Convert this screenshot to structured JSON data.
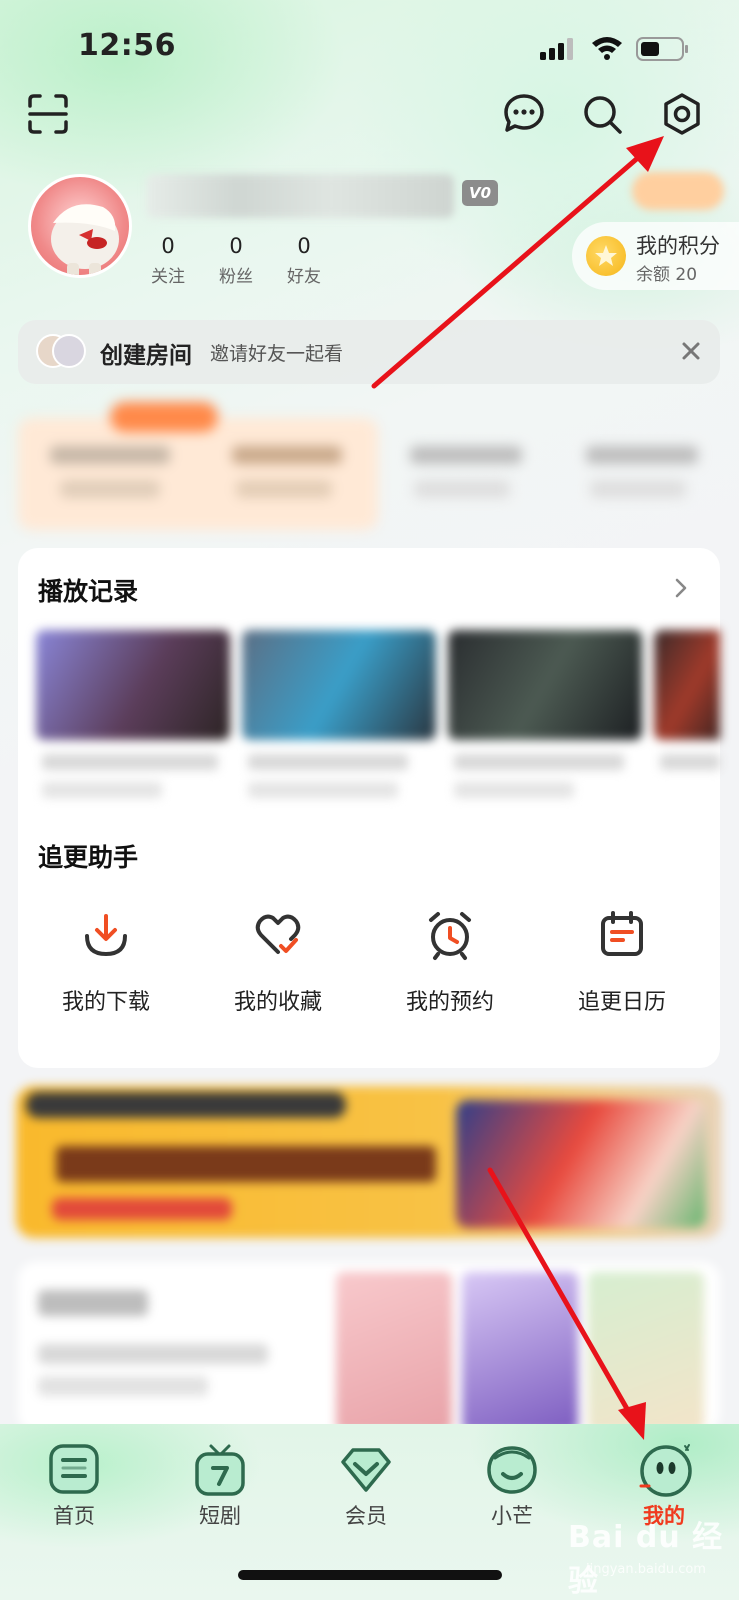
{
  "status_bar": {
    "time": "12:56"
  },
  "profile": {
    "vip_level": "V0",
    "stats": [
      {
        "value": "0",
        "label": "关注"
      },
      {
        "value": "0",
        "label": "粉丝"
      },
      {
        "value": "0",
        "label": "好友"
      }
    ],
    "points": {
      "title": "我的积分",
      "balance": "余额 20"
    }
  },
  "room_banner": {
    "title": "创建房间",
    "subtitle": "邀请好友一起看"
  },
  "history": {
    "title": "播放记录"
  },
  "assistant": {
    "title": "追更助手",
    "items": [
      {
        "label": "我的下载",
        "icon": "download-icon"
      },
      {
        "label": "我的收藏",
        "icon": "heart-check-icon"
      },
      {
        "label": "我的预约",
        "icon": "alarm-clock-icon"
      },
      {
        "label": "追更日历",
        "icon": "calendar-icon"
      }
    ]
  },
  "bottom_nav": {
    "items": [
      {
        "label": "首页",
        "icon": "home-icon"
      },
      {
        "label": "短剧",
        "icon": "tv-icon"
      },
      {
        "label": "会员",
        "icon": "diamond-icon"
      },
      {
        "label": "小芒",
        "icon": "mango-icon"
      },
      {
        "label": "我的",
        "icon": "profile-mascot-icon",
        "active": true
      }
    ]
  },
  "watermark": {
    "text": "Bai du 经验",
    "sub": "jingyan.baidu.com"
  },
  "colors": {
    "accent": "#f03a1e",
    "annotation": "#e8121a",
    "points_star": "#f6b619"
  }
}
